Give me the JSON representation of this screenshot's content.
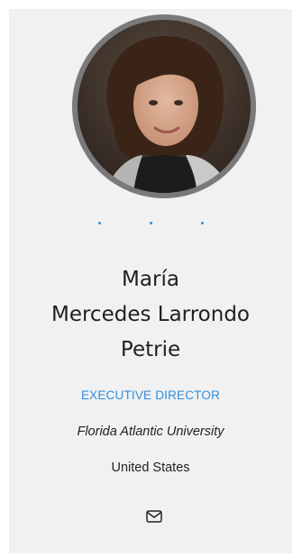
{
  "profile": {
    "name_line1": "María",
    "name_line2": "Mercedes Larrondo",
    "name_line3": "Petrie",
    "role": "EXECUTIVE DIRECTOR",
    "organization": "Florida Atlantic University",
    "country": "United States"
  },
  "icons": {
    "email": "mail-icon"
  },
  "colors": {
    "accent": "#2f8fe0",
    "card_bg": "#f1f1f1",
    "avatar_ring": "#7a7a7a"
  }
}
